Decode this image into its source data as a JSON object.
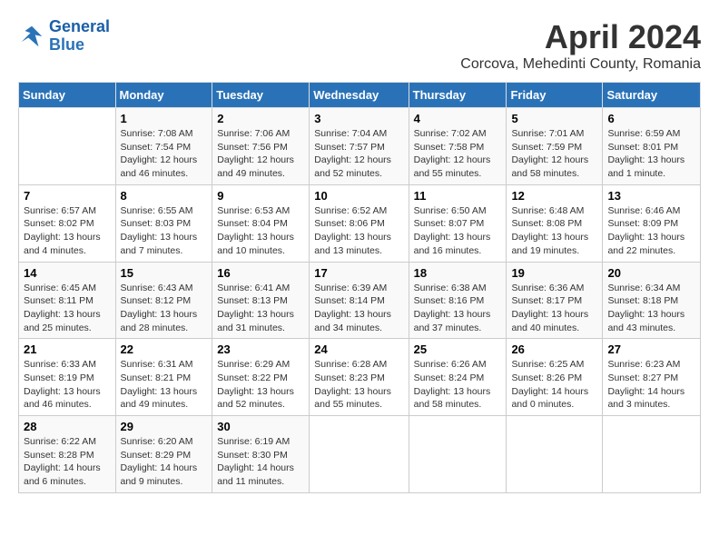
{
  "header": {
    "logo_line1": "General",
    "logo_line2": "Blue",
    "month_year": "April 2024",
    "location": "Corcova, Mehedinti County, Romania"
  },
  "days_of_week": [
    "Sunday",
    "Monday",
    "Tuesday",
    "Wednesday",
    "Thursday",
    "Friday",
    "Saturday"
  ],
  "weeks": [
    [
      {
        "num": "",
        "sunrise": "",
        "sunset": "",
        "daylight": ""
      },
      {
        "num": "1",
        "sunrise": "Sunrise: 7:08 AM",
        "sunset": "Sunset: 7:54 PM",
        "daylight": "Daylight: 12 hours and 46 minutes."
      },
      {
        "num": "2",
        "sunrise": "Sunrise: 7:06 AM",
        "sunset": "Sunset: 7:56 PM",
        "daylight": "Daylight: 12 hours and 49 minutes."
      },
      {
        "num": "3",
        "sunrise": "Sunrise: 7:04 AM",
        "sunset": "Sunset: 7:57 PM",
        "daylight": "Daylight: 12 hours and 52 minutes."
      },
      {
        "num": "4",
        "sunrise": "Sunrise: 7:02 AM",
        "sunset": "Sunset: 7:58 PM",
        "daylight": "Daylight: 12 hours and 55 minutes."
      },
      {
        "num": "5",
        "sunrise": "Sunrise: 7:01 AM",
        "sunset": "Sunset: 7:59 PM",
        "daylight": "Daylight: 12 hours and 58 minutes."
      },
      {
        "num": "6",
        "sunrise": "Sunrise: 6:59 AM",
        "sunset": "Sunset: 8:01 PM",
        "daylight": "Daylight: 13 hours and 1 minute."
      }
    ],
    [
      {
        "num": "7",
        "sunrise": "Sunrise: 6:57 AM",
        "sunset": "Sunset: 8:02 PM",
        "daylight": "Daylight: 13 hours and 4 minutes."
      },
      {
        "num": "8",
        "sunrise": "Sunrise: 6:55 AM",
        "sunset": "Sunset: 8:03 PM",
        "daylight": "Daylight: 13 hours and 7 minutes."
      },
      {
        "num": "9",
        "sunrise": "Sunrise: 6:53 AM",
        "sunset": "Sunset: 8:04 PM",
        "daylight": "Daylight: 13 hours and 10 minutes."
      },
      {
        "num": "10",
        "sunrise": "Sunrise: 6:52 AM",
        "sunset": "Sunset: 8:06 PM",
        "daylight": "Daylight: 13 hours and 13 minutes."
      },
      {
        "num": "11",
        "sunrise": "Sunrise: 6:50 AM",
        "sunset": "Sunset: 8:07 PM",
        "daylight": "Daylight: 13 hours and 16 minutes."
      },
      {
        "num": "12",
        "sunrise": "Sunrise: 6:48 AM",
        "sunset": "Sunset: 8:08 PM",
        "daylight": "Daylight: 13 hours and 19 minutes."
      },
      {
        "num": "13",
        "sunrise": "Sunrise: 6:46 AM",
        "sunset": "Sunset: 8:09 PM",
        "daylight": "Daylight: 13 hours and 22 minutes."
      }
    ],
    [
      {
        "num": "14",
        "sunrise": "Sunrise: 6:45 AM",
        "sunset": "Sunset: 8:11 PM",
        "daylight": "Daylight: 13 hours and 25 minutes."
      },
      {
        "num": "15",
        "sunrise": "Sunrise: 6:43 AM",
        "sunset": "Sunset: 8:12 PM",
        "daylight": "Daylight: 13 hours and 28 minutes."
      },
      {
        "num": "16",
        "sunrise": "Sunrise: 6:41 AM",
        "sunset": "Sunset: 8:13 PM",
        "daylight": "Daylight: 13 hours and 31 minutes."
      },
      {
        "num": "17",
        "sunrise": "Sunrise: 6:39 AM",
        "sunset": "Sunset: 8:14 PM",
        "daylight": "Daylight: 13 hours and 34 minutes."
      },
      {
        "num": "18",
        "sunrise": "Sunrise: 6:38 AM",
        "sunset": "Sunset: 8:16 PM",
        "daylight": "Daylight: 13 hours and 37 minutes."
      },
      {
        "num": "19",
        "sunrise": "Sunrise: 6:36 AM",
        "sunset": "Sunset: 8:17 PM",
        "daylight": "Daylight: 13 hours and 40 minutes."
      },
      {
        "num": "20",
        "sunrise": "Sunrise: 6:34 AM",
        "sunset": "Sunset: 8:18 PM",
        "daylight": "Daylight: 13 hours and 43 minutes."
      }
    ],
    [
      {
        "num": "21",
        "sunrise": "Sunrise: 6:33 AM",
        "sunset": "Sunset: 8:19 PM",
        "daylight": "Daylight: 13 hours and 46 minutes."
      },
      {
        "num": "22",
        "sunrise": "Sunrise: 6:31 AM",
        "sunset": "Sunset: 8:21 PM",
        "daylight": "Daylight: 13 hours and 49 minutes."
      },
      {
        "num": "23",
        "sunrise": "Sunrise: 6:29 AM",
        "sunset": "Sunset: 8:22 PM",
        "daylight": "Daylight: 13 hours and 52 minutes."
      },
      {
        "num": "24",
        "sunrise": "Sunrise: 6:28 AM",
        "sunset": "Sunset: 8:23 PM",
        "daylight": "Daylight: 13 hours and 55 minutes."
      },
      {
        "num": "25",
        "sunrise": "Sunrise: 6:26 AM",
        "sunset": "Sunset: 8:24 PM",
        "daylight": "Daylight: 13 hours and 58 minutes."
      },
      {
        "num": "26",
        "sunrise": "Sunrise: 6:25 AM",
        "sunset": "Sunset: 8:26 PM",
        "daylight": "Daylight: 14 hours and 0 minutes."
      },
      {
        "num": "27",
        "sunrise": "Sunrise: 6:23 AM",
        "sunset": "Sunset: 8:27 PM",
        "daylight": "Daylight: 14 hours and 3 minutes."
      }
    ],
    [
      {
        "num": "28",
        "sunrise": "Sunrise: 6:22 AM",
        "sunset": "Sunset: 8:28 PM",
        "daylight": "Daylight: 14 hours and 6 minutes."
      },
      {
        "num": "29",
        "sunrise": "Sunrise: 6:20 AM",
        "sunset": "Sunset: 8:29 PM",
        "daylight": "Daylight: 14 hours and 9 minutes."
      },
      {
        "num": "30",
        "sunrise": "Sunrise: 6:19 AM",
        "sunset": "Sunset: 8:30 PM",
        "daylight": "Daylight: 14 hours and 11 minutes."
      },
      {
        "num": "",
        "sunrise": "",
        "sunset": "",
        "daylight": ""
      },
      {
        "num": "",
        "sunrise": "",
        "sunset": "",
        "daylight": ""
      },
      {
        "num": "",
        "sunrise": "",
        "sunset": "",
        "daylight": ""
      },
      {
        "num": "",
        "sunrise": "",
        "sunset": "",
        "daylight": ""
      }
    ]
  ]
}
